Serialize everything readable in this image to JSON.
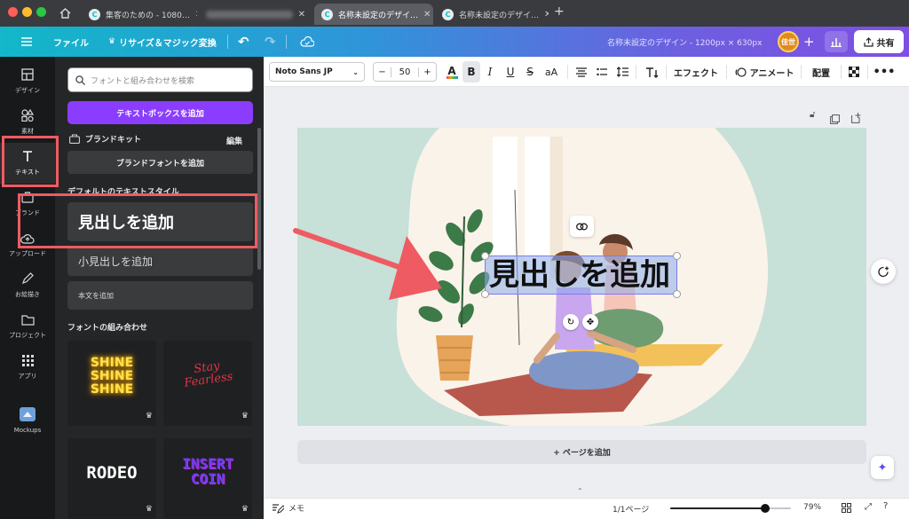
{
  "browser": {
    "tabs": [
      {
        "title": "集客のための - 1080…",
        "active": false
      },
      {
        "title": "",
        "active": false,
        "blurred": true
      },
      {
        "title": "名称未設定のデザイ…",
        "active": true
      },
      {
        "title": "名称未設定のデザイ…",
        "active": false
      }
    ],
    "new_tab": "+"
  },
  "header": {
    "menu_icon": "hamburger-icon",
    "file_label": "ファイル",
    "resize_label": "リサイズ＆マジック変換",
    "design_title": "名称未設定のデザイン - 1200px × 630px",
    "avatar_text": "佳世",
    "share_label": "共有"
  },
  "rail": {
    "items": [
      {
        "label": "デザイン",
        "icon": "layout-icon"
      },
      {
        "label": "素材",
        "icon": "shapes-icon"
      },
      {
        "label": "テキスト",
        "icon": "text-icon"
      },
      {
        "label": "ブランド",
        "icon": "brand-icon"
      },
      {
        "label": "アップロード",
        "icon": "cloud-upload-icon"
      },
      {
        "label": "お絵描き",
        "icon": "pen-icon"
      },
      {
        "label": "プロジェクト",
        "icon": "folder-icon"
      },
      {
        "label": "アプリ",
        "icon": "apps-icon"
      },
      {
        "label": "Mockups",
        "icon": "mockups-icon"
      }
    ]
  },
  "panel": {
    "search_placeholder": "フォントと組み合わせを検索",
    "add_textbox": "テキストボックスを追加",
    "brand_kit": "ブランドキット",
    "brand_edit": "編集",
    "brand_fonts": "ブランドフォントを追加",
    "default_styles_title": "デフォルトのテキストスタイル",
    "heading": "見出しを追加",
    "subheading": "小見出しを追加",
    "body": "本文を追加",
    "combos_title": "フォントの組み合わせ",
    "combos": [
      {
        "lines": [
          "SHINE",
          "SHINE",
          "SHINE"
        ]
      },
      {
        "lines": [
          "Stay",
          "Fearless"
        ]
      },
      {
        "lines": [
          "RODEO"
        ]
      },
      {
        "lines": [
          "INSERT",
          "COIN"
        ]
      }
    ]
  },
  "toolbar": {
    "font": "Noto Sans JP",
    "font_size": "50",
    "minus": "−",
    "plus": "+",
    "effects": "エフェクト",
    "animate": "アニメート",
    "position": "配置"
  },
  "canvas": {
    "text": "見出しを追加",
    "add_page": "+ ページを追加"
  },
  "status": {
    "notes": "メモ",
    "pages": "1/1ページ",
    "zoom": "79%",
    "zoom_level": 0.79
  },
  "colors": {
    "accent": "#8b3dff",
    "annotation": "#ef5b62",
    "canvas_bg": "#c7e0d8"
  }
}
